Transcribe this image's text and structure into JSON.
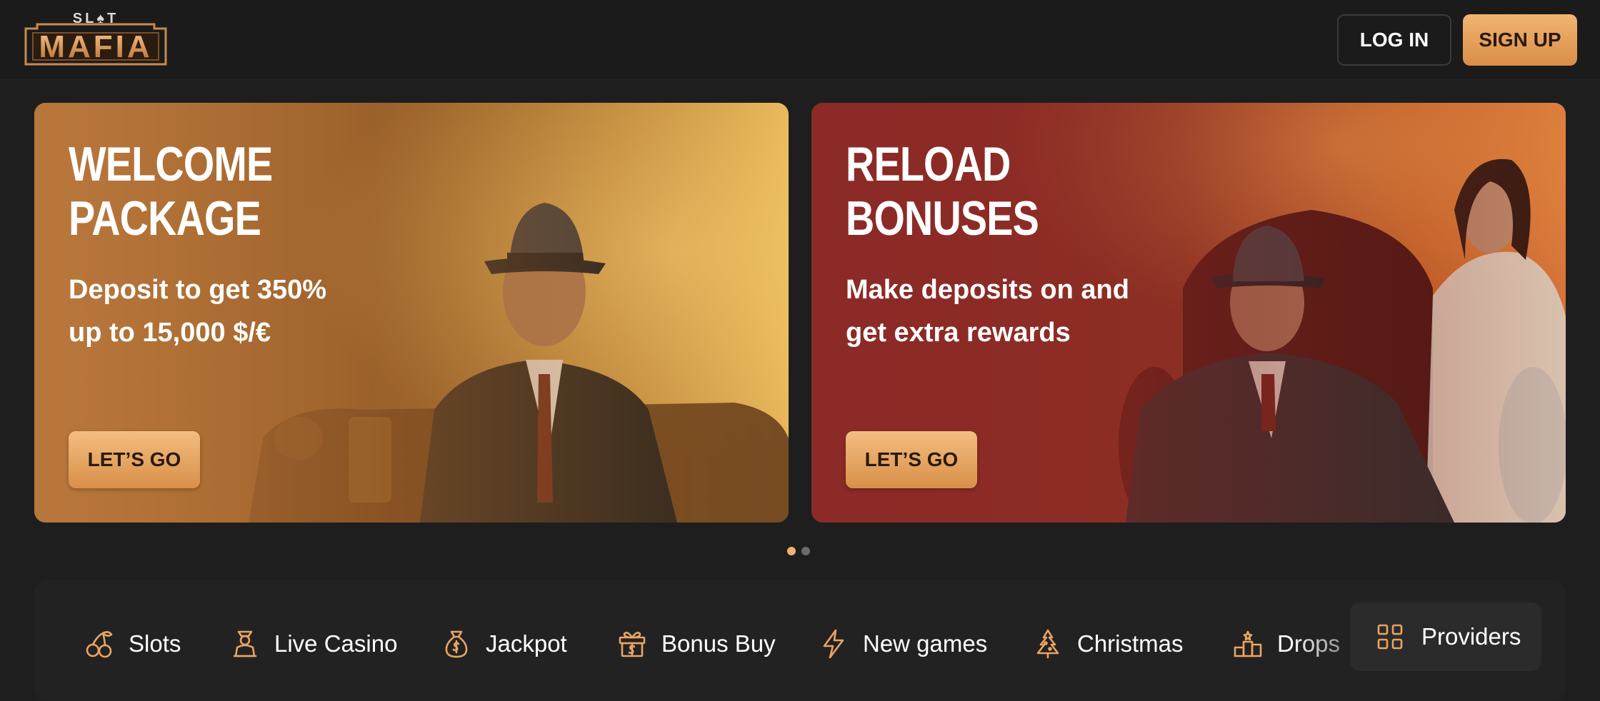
{
  "brand": {
    "logo_top": "SL♠T",
    "logo_main": "MAFIA",
    "accent": "#e9a462"
  },
  "header": {
    "login_label": "LOG IN",
    "signup_label": "SIGN UP"
  },
  "banners": [
    {
      "title_line1": "WELCOME",
      "title_line2": "PACKAGE",
      "subtitle_line1": "Deposit to get 350%",
      "subtitle_line2": "up to 15,000 $/€",
      "button_label": "LET’S GO"
    },
    {
      "title_line1": "RELOAD",
      "title_line2": "BONUSES",
      "subtitle_line1": "Make deposits on and",
      "subtitle_line2": "get extra rewards",
      "button_label": "LET’S GO"
    }
  ],
  "carousel": {
    "active": 1,
    "total": 2
  },
  "categories": [
    {
      "label": "Slots",
      "icon": "cherries-icon"
    },
    {
      "label": "Live Casino",
      "icon": "dealer-icon"
    },
    {
      "label": "Jackpot",
      "icon": "money-bag-icon"
    },
    {
      "label": "Bonus Buy",
      "icon": "gift-icon"
    },
    {
      "label": "New games",
      "icon": "lightning-icon"
    },
    {
      "label": "Christmas",
      "icon": "tree-icon"
    },
    {
      "label": "Drops",
      "icon": "podium-icon"
    }
  ],
  "providers_label": "Providers"
}
